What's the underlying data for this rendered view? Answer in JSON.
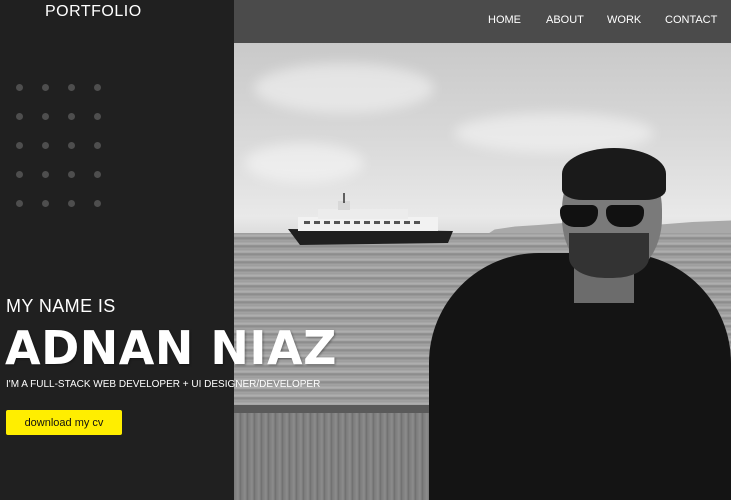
{
  "header": {
    "logo": "PORTFOLIO",
    "nav": [
      {
        "label": "HOME"
      },
      {
        "label": "ABOUT"
      },
      {
        "label": "WORK"
      },
      {
        "label": "CONTACT"
      }
    ]
  },
  "hero": {
    "intro": "MY NAME IS",
    "name": "ADNAN NIAZ",
    "tagline": "I'M A FULL-STACK WEB DEVELOPER + UI DESIGNER/DEVELOPER",
    "cta_label": "download my cv"
  },
  "colors": {
    "sidebar": "#202020",
    "navbar": "#4b4b4b",
    "accent": "#ffee00",
    "text": "#ffffff"
  }
}
